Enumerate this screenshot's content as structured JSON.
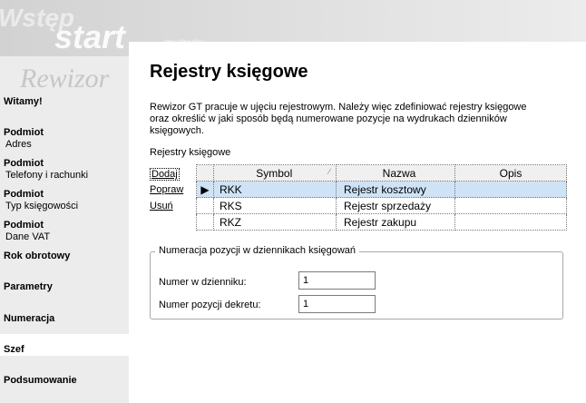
{
  "banner": {
    "word1": "Wstęp",
    "word2": "start",
    "logo": "Rewizor"
  },
  "sidebar": {
    "items": [
      {
        "label": "Witamy!"
      },
      {
        "label": "Podmiot",
        "sub": "Adres"
      },
      {
        "label": "Podmiot",
        "sub": "Telefony i rachunki"
      },
      {
        "label": "Podmiot",
        "sub": "Typ księgowości"
      },
      {
        "label": "Podmiot",
        "sub": "Dane VAT"
      },
      {
        "label": "Rok obrotowy"
      },
      {
        "label": "Parametry"
      },
      {
        "label": "Numeracja"
      },
      {
        "label": "Szef"
      },
      {
        "label": "Podsumowanie"
      }
    ],
    "active_index": 6
  },
  "main": {
    "title": "Rejestry księgowe",
    "description": "Rewizor GT pracuje w ujęciu rejestrowym. Należy więc zdefiniować rejestry księgowe oraz określić w jaki sposób będą numerowane pozycje na wydrukach dzienników księgowych.",
    "section_label": "Rejestry księgowe",
    "actions": {
      "add": "Dodaj",
      "edit": "Popraw",
      "delete": "Usuń"
    },
    "table": {
      "columns": [
        "Symbol",
        "Nazwa",
        "Opis"
      ],
      "rows": [
        {
          "symbol": "RKK",
          "name": "Rejestr kosztowy",
          "desc": ""
        },
        {
          "symbol": "RKS",
          "name": "Rejestr sprzedaży",
          "desc": ""
        },
        {
          "symbol": "RKZ",
          "name": "Rejestr zakupu",
          "desc": ""
        }
      ],
      "selected_row": 0
    },
    "numbering": {
      "legend": "Numeracja pozycji w dziennikach księgowań",
      "journal_label": "Numer w dzienniku:",
      "journal_value": "1",
      "entry_label": "Numer pozycji dekretu:",
      "entry_value": "1"
    }
  },
  "icons": {
    "row_indicator": "triangle-right-icon",
    "sort": "sort-icon"
  }
}
